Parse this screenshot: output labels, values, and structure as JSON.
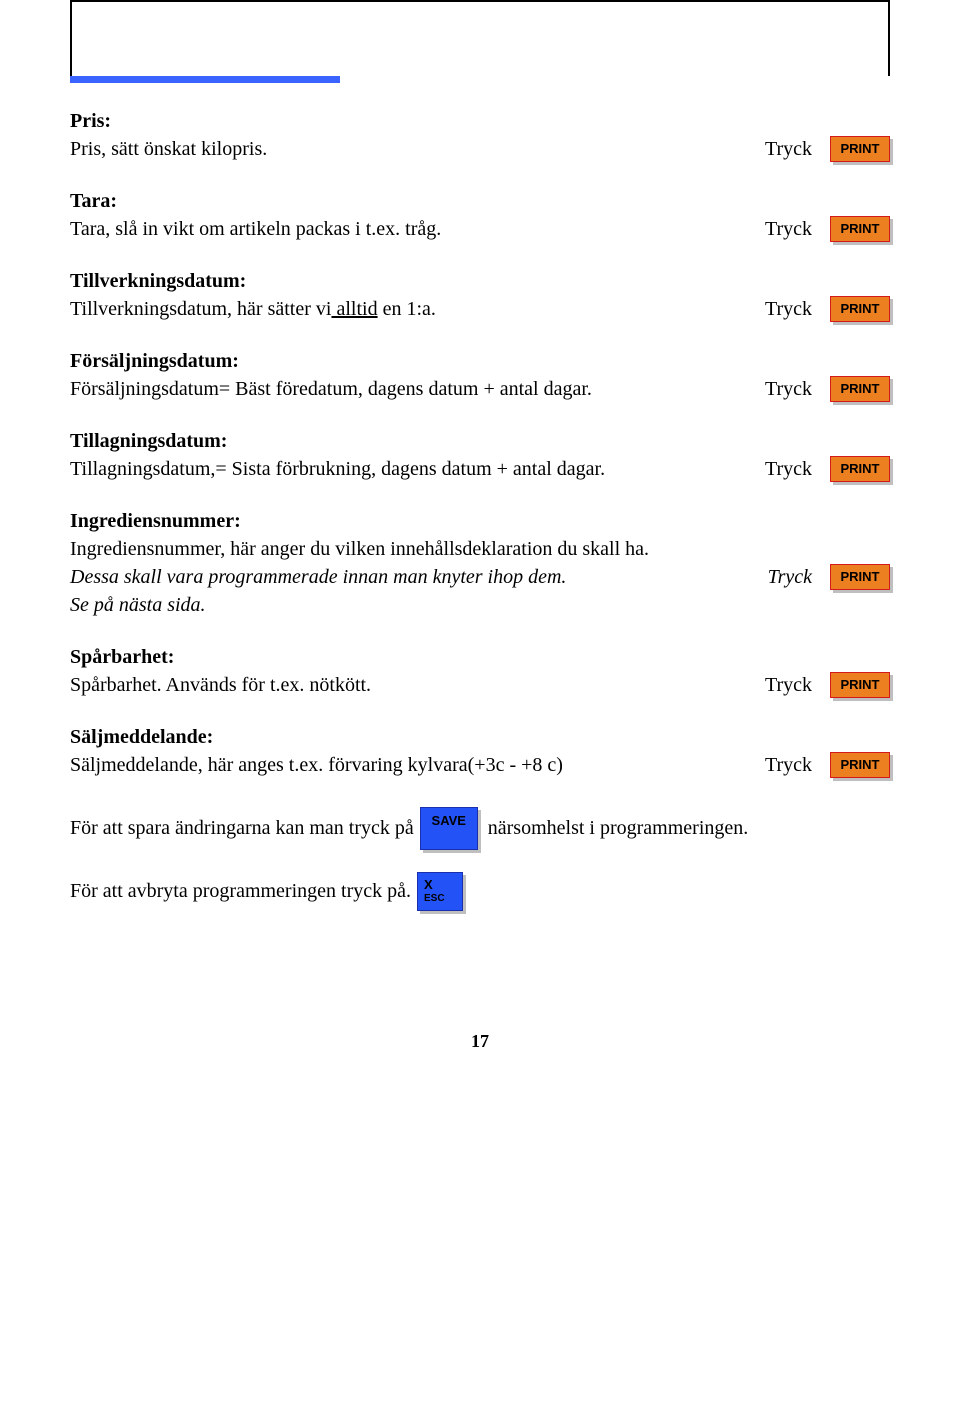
{
  "buttons": {
    "print": "PRINT",
    "save": "SAVE",
    "esc_x": "X",
    "esc_label": "ESC"
  },
  "tryck": "Tryck",
  "sections": {
    "pris": {
      "heading": "Pris:",
      "body": "Pris, sätt önskat kilopris."
    },
    "tara": {
      "heading": "Tara:",
      "body": "Tara, slå in vikt om artikeln packas i t.ex. tråg."
    },
    "tillverk": {
      "heading": "Tillverkningsdatum:",
      "body_pre": "Tillverkningsdatum, här sätter vi",
      "body_underline": " alltid",
      "body_post": " en 1:a."
    },
    "forsalj": {
      "heading": "Försäljningsdatum:",
      "body": "Försäljningsdatum= Bäst föredatum, dagens datum + antal dagar."
    },
    "tillagn": {
      "heading": "Tillagningsdatum:",
      "body": "Tillagningsdatum,= Sista förbrukning, dagens datum + antal dagar."
    },
    "ingred": {
      "heading": "Ingrediensnummer:",
      "line1": "Ingrediensnummer, här anger du vilken innehållsdeklaration du skall ha.",
      "line2": "Dessa skall vara programmerade innan man knyter ihop dem.",
      "line3": "Se på nästa sida."
    },
    "spar": {
      "heading": "Spårbarhet:",
      "body": "Spårbarhet. Används för t.ex. nötkött."
    },
    "salj": {
      "heading": "Säljmeddelande:",
      "body": "Säljmeddelande, här anges t.ex. förvaring kylvara(+3c - +8 c)"
    }
  },
  "footer": {
    "save_pre": "För att spara ändringarna kan man tryck på",
    "save_post": "närsomhelst i programmeringen.",
    "esc_pre": "För att avbryta programmeringen tryck på."
  },
  "page_number": "17"
}
